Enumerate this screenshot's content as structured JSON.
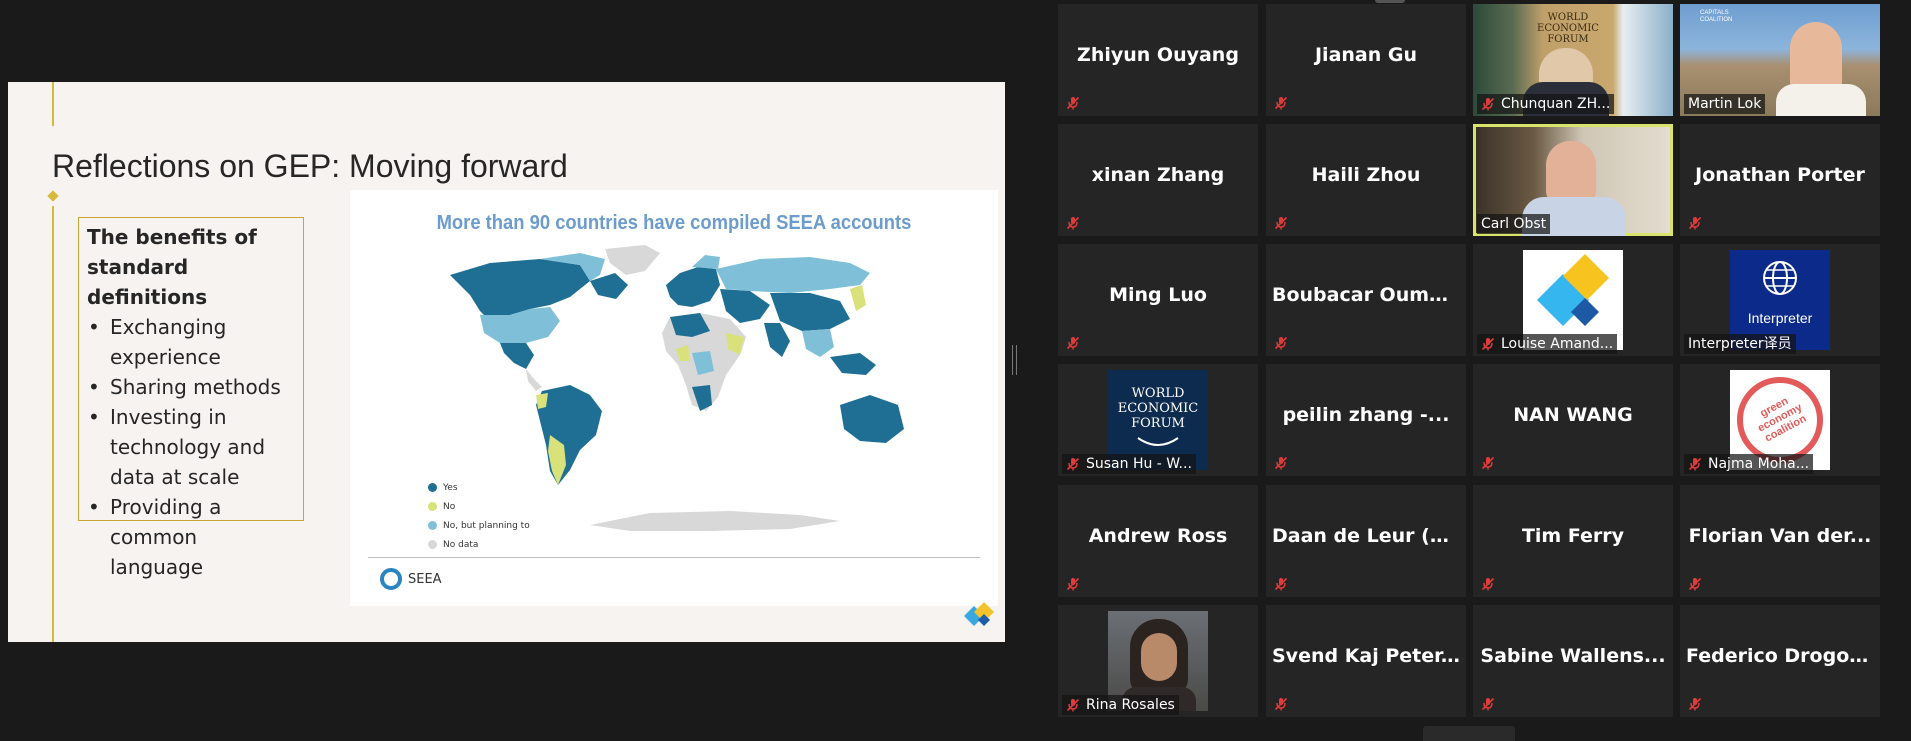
{
  "slide": {
    "title": "Reflections on GEP: Moving forward",
    "benefits_heading": "The benefits of standard definitions",
    "benefits": [
      "Exchanging experience",
      "Sharing methods",
      "Investing in technology and data at scale",
      "Providing a common language"
    ],
    "map_title": "More than 90 countries have compiled SEEA accounts",
    "legend": [
      {
        "label": "Yes",
        "color": "#1e6f93"
      },
      {
        "label": "No",
        "color": "#d9e27a"
      },
      {
        "label": "No, but planning to",
        "color": "#7fc0d8"
      },
      {
        "label": "No data",
        "color": "#d8d8d8"
      }
    ],
    "seea_label": "SEEA"
  },
  "participants": [
    {
      "name": "Zhiyun Ouyang"
    },
    {
      "name": "Jianan Gu"
    },
    {
      "name": "Chunquan ZH...",
      "video": "wef-office",
      "video_text": "WORLD ECONOMIC FORUM"
    },
    {
      "name": "Martin Lok",
      "video": "outdoor",
      "mic": false,
      "video_text": "CAPITALS COALITION"
    },
    {
      "name": "xinan Zhang"
    },
    {
      "name": "Haili Zhou"
    },
    {
      "name": "Carl Obst",
      "video": "office",
      "speaker": true,
      "mic": false
    },
    {
      "name": "Jonathan Porter"
    },
    {
      "name": "Ming Luo"
    },
    {
      "name": "Boubacar Ouma..."
    },
    {
      "name": "Louise Amand...",
      "video": "logo-diamond"
    },
    {
      "name": "Interpreter译员",
      "video": "logo-interpreter",
      "mic": false,
      "video_text": "Interpreter"
    },
    {
      "name": "Susan Hu - W...",
      "video": "logo-wef",
      "video_text": "WORLD ECONOMIC FORUM"
    },
    {
      "name": "peilin zhang -..."
    },
    {
      "name": "NAN WANG"
    },
    {
      "name": "Najma Moha...",
      "video": "logo-gec",
      "video_text": "green economy coalition"
    },
    {
      "name": "Andrew Ross"
    },
    {
      "name": "Daan de Leur (N..."
    },
    {
      "name": "Tim Ferry"
    },
    {
      "name": "Florian Van der..."
    },
    {
      "name": "Rina Rosales",
      "video": "photo"
    },
    {
      "name": "Svend Kaj Peter..."
    },
    {
      "name": "Sabine Wallens..."
    },
    {
      "name": "Federico Drogo,..."
    }
  ],
  "colors": {
    "background": "#1a1a1a",
    "tile": "#252525",
    "speaker_outline": "#d7e36b",
    "slide_accent": "#d8b93a"
  }
}
